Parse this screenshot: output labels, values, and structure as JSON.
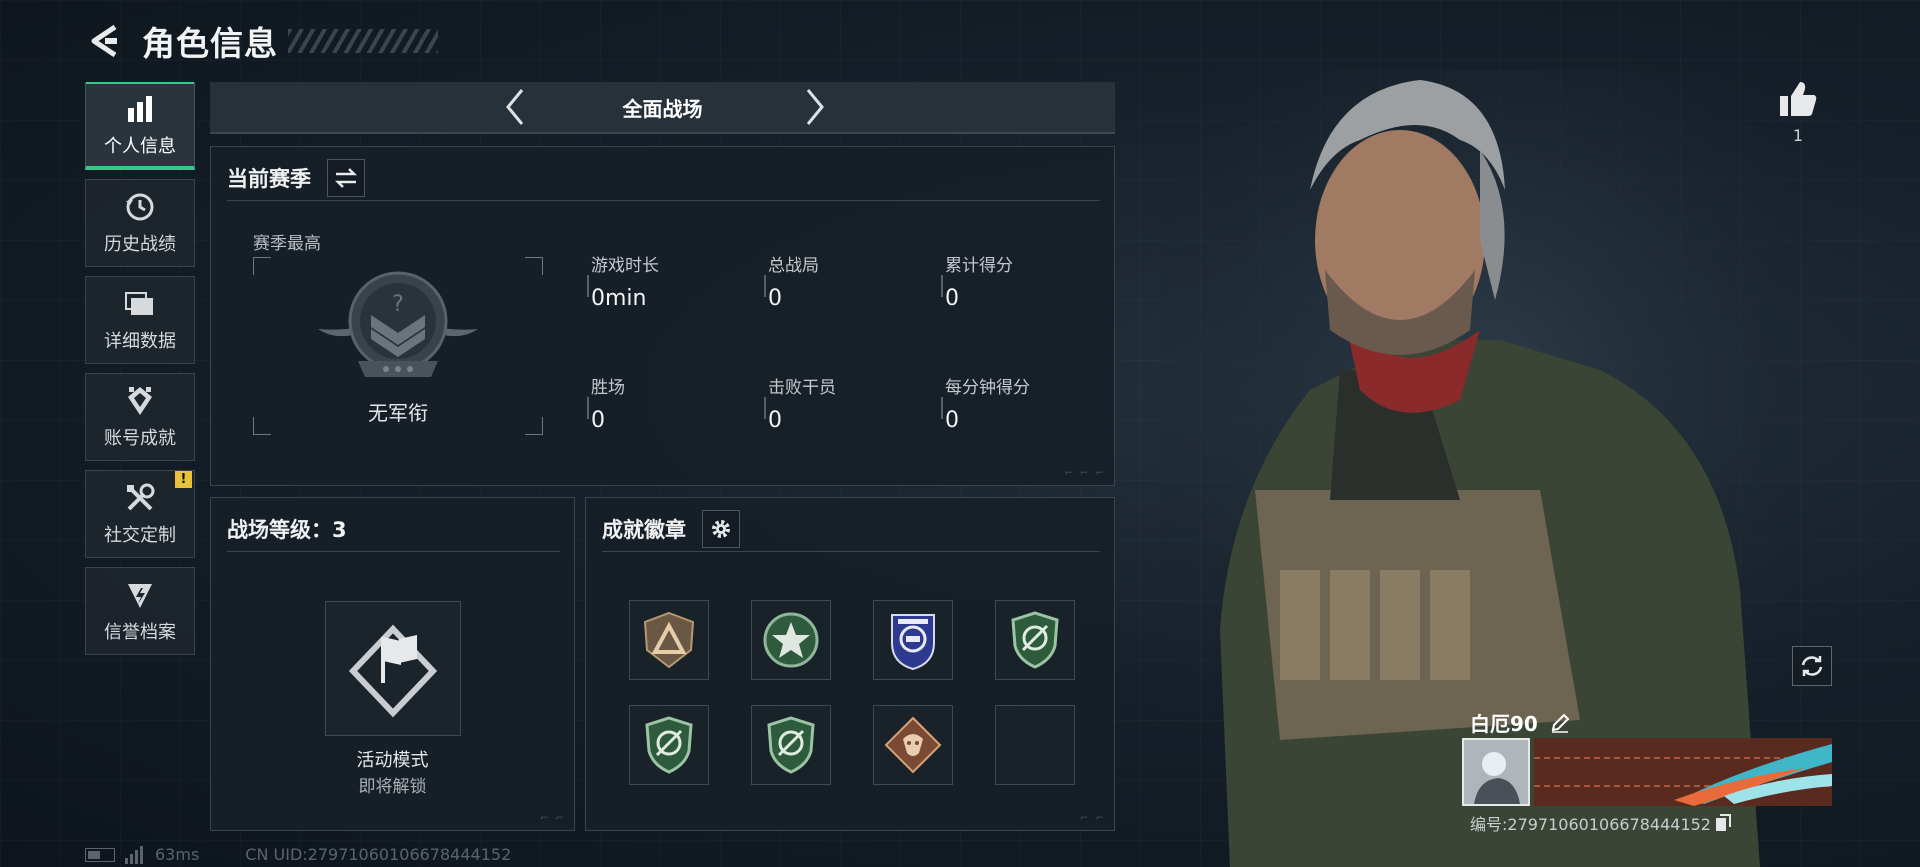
{
  "header": {
    "title": "角色信息"
  },
  "sidebar": {
    "items": [
      {
        "label": "个人信息",
        "icon": "bar-chart-icon",
        "active": true
      },
      {
        "label": "历史战绩",
        "icon": "history-clock-icon"
      },
      {
        "label": "详细数据",
        "icon": "folder-icon"
      },
      {
        "label": "账号成就",
        "icon": "achievement-icon"
      },
      {
        "label": "社交定制",
        "icon": "tools-icon",
        "alert": "!"
      },
      {
        "label": "信誉档案",
        "icon": "reputation-icon"
      }
    ]
  },
  "mode_selector": {
    "title": "全面战场"
  },
  "season": {
    "title": "当前赛季",
    "best_label": "赛季最高",
    "rank_name": "无军衔",
    "stats": [
      {
        "label": "游戏时长",
        "value": "0min"
      },
      {
        "label": "总战局",
        "value": "0"
      },
      {
        "label": "累计得分",
        "value": "0"
      },
      {
        "label": "胜场",
        "value": "0"
      },
      {
        "label": "击败干员",
        "value": "0"
      },
      {
        "label": "每分钟得分",
        "value": "0"
      }
    ]
  },
  "battle_level": {
    "title": "战场等级：3",
    "mode_name": "活动模式",
    "lock_text": "即将解锁"
  },
  "badges": {
    "title": "成就徽章",
    "items": [
      {
        "name": "bronze-triangle-badge"
      },
      {
        "name": "green-star-badge"
      },
      {
        "name": "blue-police-badge"
      },
      {
        "name": "green-shield-badge"
      },
      {
        "name": "green-shield-badge"
      },
      {
        "name": "green-shield-badge"
      },
      {
        "name": "orange-diamond-badge"
      },
      {
        "name": "empty-slot"
      }
    ]
  },
  "footer": {
    "ping": "63ms",
    "uid": "CN UID:2797106010667844415​2"
  },
  "likes": {
    "count": "1"
  },
  "profile": {
    "name": "白厄90",
    "id_text": "编号:279710601066784441​52"
  },
  "colors": {
    "accent": "#34c98a",
    "alert": "#e8c23a",
    "background": "#16202a"
  }
}
